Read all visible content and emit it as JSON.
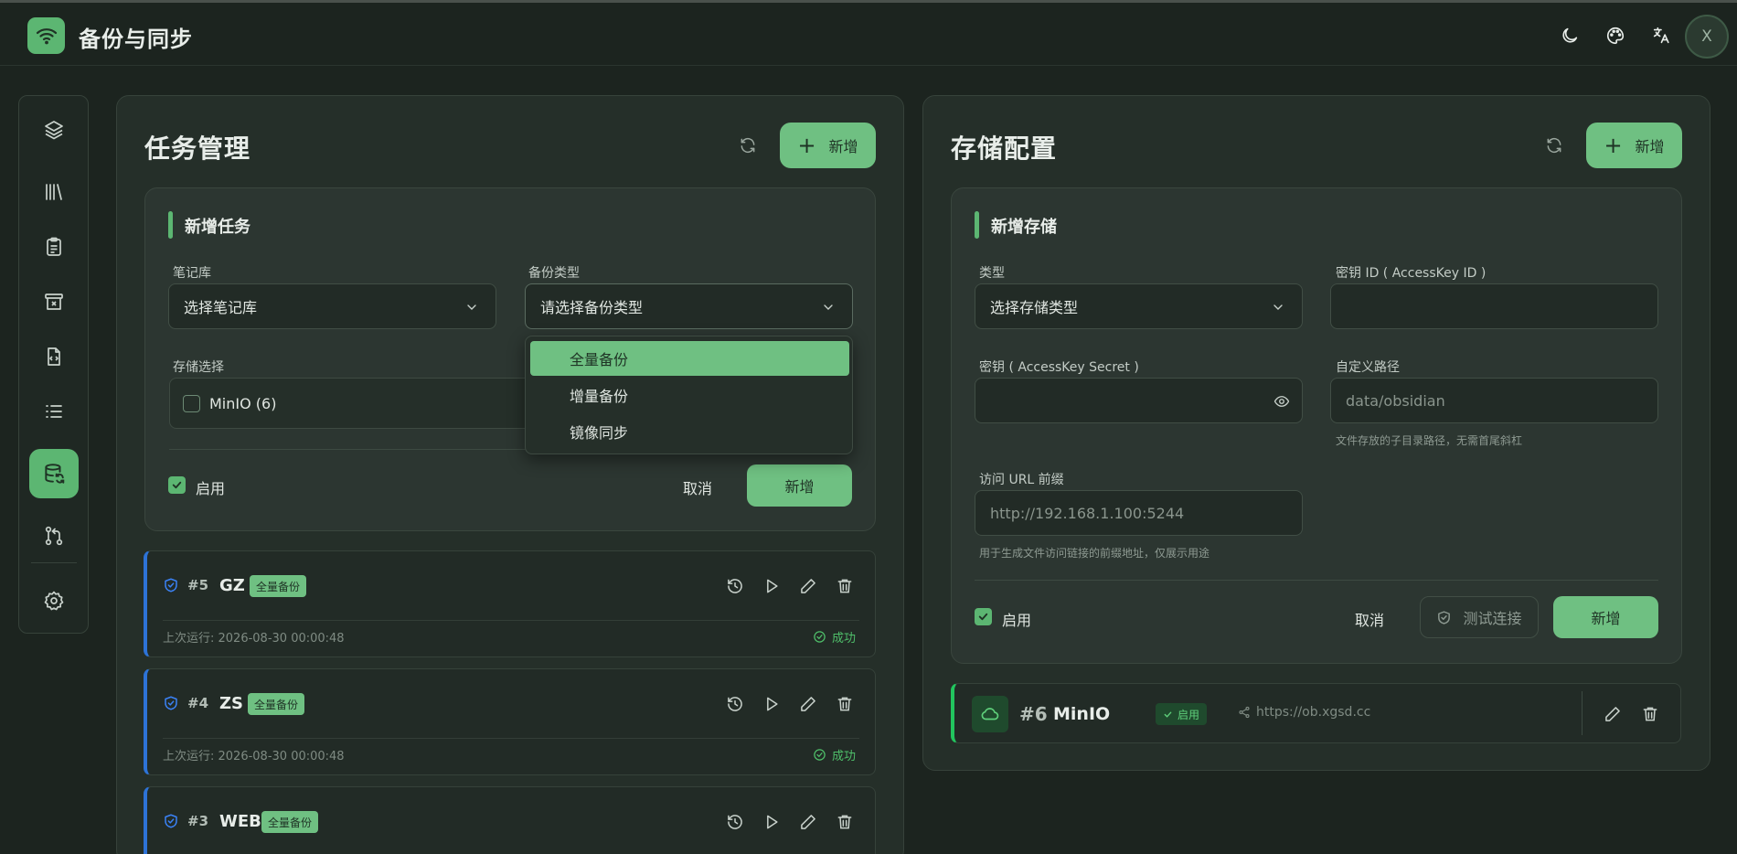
{
  "header": {
    "title": "备份与同步",
    "avatar_letter": "X",
    "icons": [
      "wifi-icon",
      "moon-icon",
      "palette-icon",
      "translate-icon"
    ]
  },
  "sidebar": {
    "items": [
      "layers-icon",
      "library-icon",
      "clipboard-icon",
      "archive-icon",
      "code-file-icon",
      "list-icon",
      "database-sync-icon",
      "git-pull-request-icon",
      "settings-icon"
    ],
    "active": "database-sync-icon"
  },
  "tasks_panel": {
    "title": "任务管理",
    "add_label": "新增",
    "form": {
      "title": "新增任务",
      "vault_label": "笔记库",
      "vault_value": "选择笔记库",
      "backup_type_label": "备份类型",
      "backup_type_value": "请选择备份类型",
      "storage_label": "存储选择",
      "storage_option": "MinIO (6)",
      "enabled_label": "启用",
      "cancel_label": "取消",
      "submit_label": "新增"
    },
    "dropdown_options": [
      "全量备份",
      "增量备份",
      "镜像同步"
    ],
    "items": [
      {
        "num": "#5",
        "name": "GZ",
        "badge": "全量备份",
        "time": "上次运行: 2026-08-30 00:00:48",
        "status": "成功"
      },
      {
        "num": "#4",
        "name": "ZS",
        "badge": "全量备份",
        "time": "上次运行: 2026-08-30 00:00:48",
        "status": "成功"
      },
      {
        "num": "#3",
        "name": "WEB",
        "badge": "全量备份"
      }
    ]
  },
  "storage_panel": {
    "title": "存储配置",
    "add_label": "新增",
    "form": {
      "title": "新增存储",
      "type_label": "类型",
      "type_value": "选择存储类型",
      "access_key_label": "密钥 ID ( AccessKey ID )",
      "secret_label": "密钥 ( AccessKey Secret )",
      "path_label": "自定义路径",
      "path_placeholder": "data/obsidian",
      "path_hint": "文件存放的子目录路径，无需首尾斜杠",
      "url_label": "访问 URL 前缀",
      "url_placeholder": "http://192.168.1.100:5244",
      "url_hint": "用于生成文件访问链接的前缀地址，仅展示用途",
      "enabled_label": "启用",
      "cancel_label": "取消",
      "test_label": "测试连接",
      "submit_label": "新增"
    },
    "items": [
      {
        "num": "#6",
        "name": "MinIO",
        "status": "启用",
        "url": "https://ob.xgsd.cc"
      }
    ]
  },
  "colors": {
    "accent": "#6fc082",
    "background": "#1c241f",
    "panel": "#252f29",
    "task_border": "#2d73d7",
    "success": "#4fbf6a"
  }
}
